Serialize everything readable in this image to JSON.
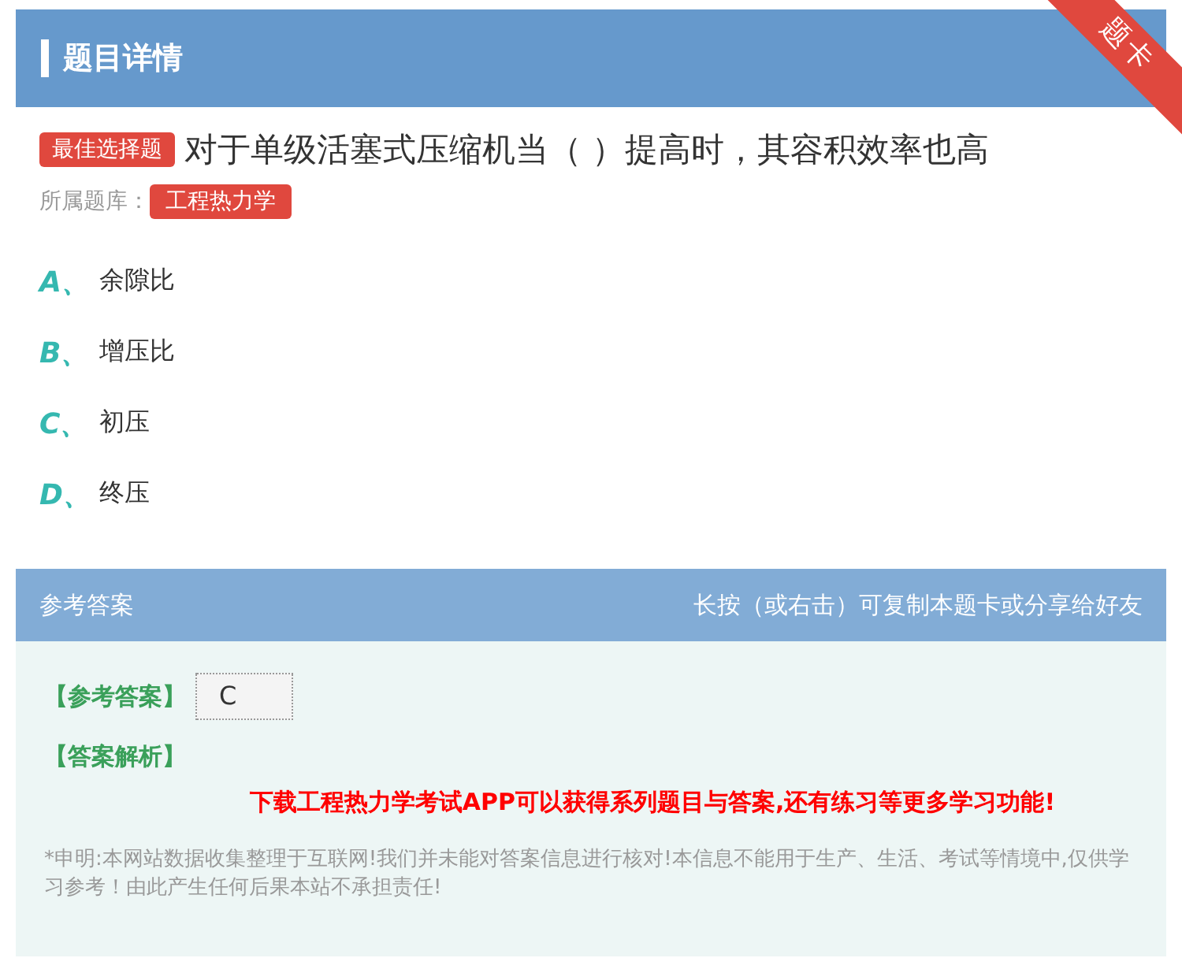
{
  "header": {
    "title": "题目详情",
    "ribbon": "题卡"
  },
  "question": {
    "type_badge": "最佳选择题",
    "text": "对于单级活塞式压缩机当（ ）提高时，其容积效率也高",
    "bank_label": "所属题库：",
    "bank": "工程热力学"
  },
  "options": [
    {
      "letter": "A、",
      "text": "余隙比"
    },
    {
      "letter": "B、",
      "text": "增压比"
    },
    {
      "letter": "C、",
      "text": "初压"
    },
    {
      "letter": "D、",
      "text": "终压"
    }
  ],
  "answer_section": {
    "title": "参考答案",
    "hint": "长按（或右击）可复制本题卡或分享给好友",
    "answer_label": "【参考答案】",
    "answer": "C",
    "analysis_label": "【答案解析】",
    "promo": "下载工程热力学考试APP可以获得系列题目与答案,还有练习等更多学习功能!",
    "disclaimer": "*申明:本网站数据收集整理于互联网!我们并未能对答案信息进行核对!本信息不能用于生产、生活、考试等情境中,仅供学习参考！由此产生任何后果本站不承担责任!"
  }
}
